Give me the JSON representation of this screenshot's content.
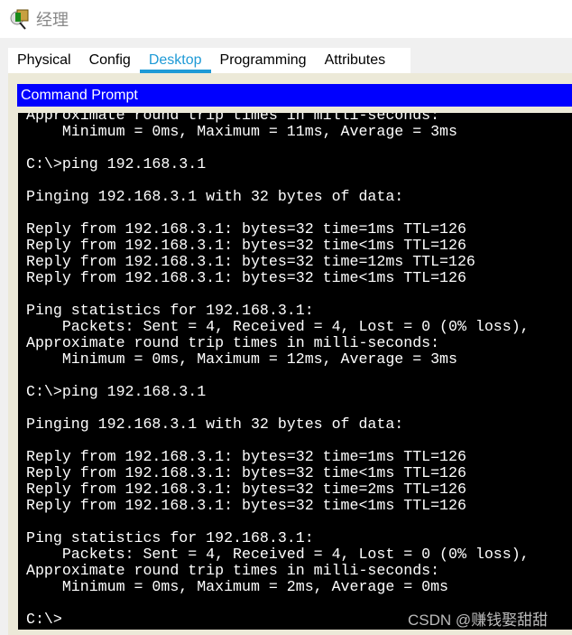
{
  "window": {
    "title": "经理",
    "icon": "packet-tracer-pc-icon"
  },
  "tabs": [
    {
      "label": "Physical"
    },
    {
      "label": "Config"
    },
    {
      "label": "Desktop",
      "active": true
    },
    {
      "label": "Programming"
    },
    {
      "label": "Attributes"
    }
  ],
  "command_prompt": {
    "title": "Command Prompt",
    "output": "Approximate round trip times in milli-seconds:\n    Minimum = 0ms, Maximum = 11ms, Average = 3ms\n\nC:\\>ping 192.168.3.1\n\nPinging 192.168.3.1 with 32 bytes of data:\n\nReply from 192.168.3.1: bytes=32 time=1ms TTL=126\nReply from 192.168.3.1: bytes=32 time<1ms TTL=126\nReply from 192.168.3.1: bytes=32 time=12ms TTL=126\nReply from 192.168.3.1: bytes=32 time<1ms TTL=126\n\nPing statistics for 192.168.3.1:\n    Packets: Sent = 4, Received = 4, Lost = 0 (0% loss),\nApproximate round trip times in milli-seconds:\n    Minimum = 0ms, Maximum = 12ms, Average = 3ms\n\nC:\\>ping 192.168.3.1\n\nPinging 192.168.3.1 with 32 bytes of data:\n\nReply from 192.168.3.1: bytes=32 time=1ms TTL=126\nReply from 192.168.3.1: bytes=32 time<1ms TTL=126\nReply from 192.168.3.1: bytes=32 time=2ms TTL=126\nReply from 192.168.3.1: bytes=32 time<1ms TTL=126\n\nPing statistics for 192.168.3.1:\n    Packets: Sent = 4, Received = 4, Lost = 0 (0% loss),\nApproximate round trip times in milli-seconds:\n    Minimum = 0ms, Maximum = 2ms, Average = 0ms\n\nC:\\>"
  },
  "watermark": "CSDN @赚钱娶甜甜",
  "colors": {
    "accent": "#1e9ad6",
    "titlebar": "#0000ff",
    "terminal_bg": "#000000"
  }
}
